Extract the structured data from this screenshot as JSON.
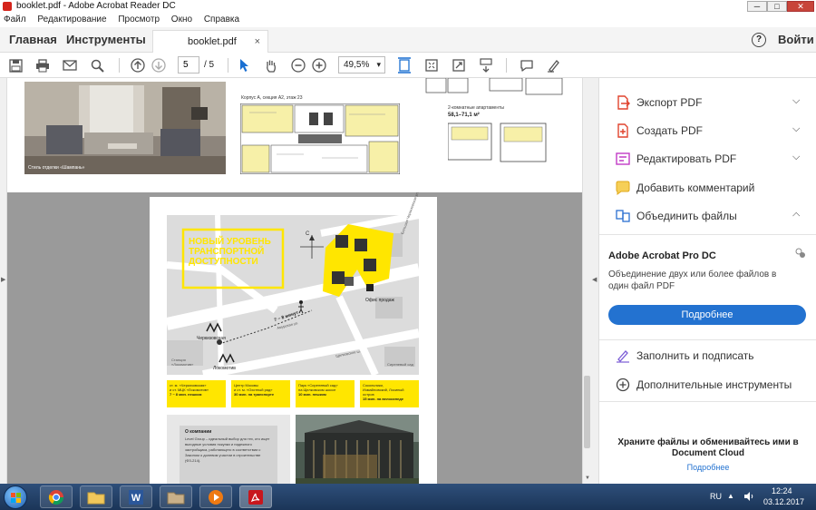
{
  "window": {
    "title": "booklet.pdf - Adobe Acrobat Reader DC",
    "minimize": "─",
    "maximize": "□",
    "close": "✕"
  },
  "menu": [
    "Файл",
    "Редактирование",
    "Просмотр",
    "Окно",
    "Справка"
  ],
  "tabs": {
    "home": "Главная",
    "tools": "Инструменты",
    "document": "booklet.pdf",
    "close": "×",
    "help": "?",
    "signin": "Войти"
  },
  "toolbar": {
    "page_current": "5",
    "page_total": "/ 5",
    "zoom": "49,5%",
    "zoom_arrow": "▾"
  },
  "page_top": {
    "caption": "Стиль отделки «Шампань»",
    "plan_title": "Корпус А, секция А2, этаж 23",
    "apt_title": "2-комнатные апартаменты",
    "apt_area": "58,1–71,1 м²"
  },
  "page_map": {
    "headline": [
      "НОВЫЙ УРОВЕНЬ",
      "ТРАНСПОРТНОЙ",
      "ДОСТУПНОСТИ"
    ],
    "metro_cherk": "Черкизовская",
    "metro_lok": "Локомотив",
    "walk": "7 ~ 8 минут",
    "office": "Офис продаж",
    "street_a": "Амурская ул.",
    "street_b": "Щелковское ш.",
    "street_c": "Большая Черкизовская ул.",
    "station": "Станция «Локомотив»",
    "sq": "Сиреневый сад",
    "compass": "С",
    "yellow_boxes": [
      {
        "t1": "ст. м. «Черкизовская»",
        "t2": "и ст. МЦК «Локомотив»",
        "t3": "7 ~ 8 мин. пешком"
      },
      {
        "t1": "Центр Москвы",
        "t2": "и ст. м. «Охотный ряд»",
        "t3": "30 мин. на транспорте"
      },
      {
        "t1": "Парк «Сиреневый сад»",
        "t2": "на Щелковском шоссе",
        "t3": "10 мин. пешком"
      },
      {
        "t1": "Сокольники,",
        "t2": "Измайловский, Лосиный остров",
        "t3": "15 мин. на велосипеде"
      }
    ],
    "about_title": "О компании",
    "about_text": "Level Group – идеальный выбор для тех, кто ищет выгодные условия покупки и надежного застройщика, работающего в соответствии с Законом о долевом участии в строительстве (ФЗ-214)."
  },
  "sidebar": {
    "tools": [
      {
        "label": "Экспорт PDF",
        "color": "#e0442e"
      },
      {
        "label": "Создать PDF",
        "color": "#e0442e"
      },
      {
        "label": "Редактировать PDF",
        "color": "#c23bc6"
      },
      {
        "label": "Добавить комментарий",
        "color": "#f2b321"
      },
      {
        "label": "Объединить файлы",
        "color": "#2b6fd1"
      }
    ],
    "promo_title": "Adobe Acrobat Pro DC",
    "promo_text": "Объединение двух или более файлов в один файл PDF",
    "promo_button": "Подробнее",
    "tools2": [
      {
        "label": "Заполнить и подписать",
        "color": "#7b5cd6"
      },
      {
        "label": "Дополнительные инструменты",
        "color": "#444444"
      }
    ],
    "cloud_text": "Храните файлы и обменивайтесь ими в Document Cloud",
    "cloud_link": "Подробнее"
  },
  "taskbar": {
    "lang": "RU",
    "time": "12:24",
    "date": "03.12.2017"
  }
}
